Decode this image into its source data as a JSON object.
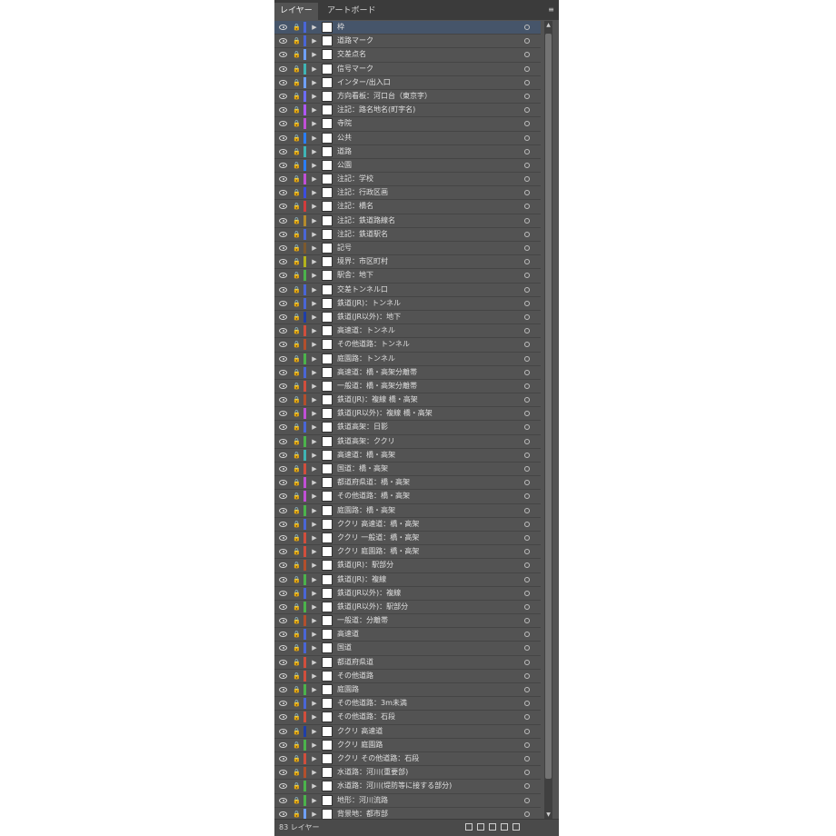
{
  "tabs": [
    "レイヤー",
    "アートボード"
  ],
  "footer": {
    "text": "83 レイヤー"
  },
  "layers": [
    {
      "name": "枠",
      "color": "#4a66d6",
      "selected": true
    },
    {
      "name": "道路マーク",
      "color": "#4a66d6"
    },
    {
      "name": "交差点名",
      "color": "#6ea0ff"
    },
    {
      "name": "信号マーク",
      "color": "#3fb5b5"
    },
    {
      "name": "インター/出入口",
      "color": "#6ea0ff"
    },
    {
      "name": "方向看板：河口台（東京字）",
      "color": "#6c6cff"
    },
    {
      "name": "注記：路名地名(町字名)",
      "color": "#b057ff"
    },
    {
      "name": "寺院",
      "color": "#c14fd6"
    },
    {
      "name": "公共",
      "color": "#2a7eff"
    },
    {
      "name": "道路",
      "color": "#3fb5b5"
    },
    {
      "name": "公園",
      "color": "#2a7eff"
    },
    {
      "name": "注記：学校",
      "color": "#c14fd6"
    },
    {
      "name": "注記：行政区画",
      "color": "#3b4de0"
    },
    {
      "name": "注記：橋名",
      "color": "#d13c3c"
    },
    {
      "name": "注記：鉄道路線名",
      "color": "#b58b2c"
    },
    {
      "name": "注記：鉄道駅名",
      "color": "#4a66d6"
    },
    {
      "name": "記号",
      "color": "#7c5a2e"
    },
    {
      "name": "境界：市区町村",
      "color": "#b3b31c"
    },
    {
      "name": "駅舎：地下",
      "color": "#4bb34b"
    },
    {
      "name": "交差トンネル口",
      "color": "#4a66d6"
    },
    {
      "name": "鉄道(JR)：トンネル",
      "color": "#4a66d6"
    },
    {
      "name": "鉄道(JR以外)：地下",
      "color": "#1f3ea8"
    },
    {
      "name": "高速道：トンネル",
      "color": "#d14e3c"
    },
    {
      "name": "その他道路：トンネル",
      "color": "#b34f2c"
    },
    {
      "name": "庭園路：トンネル",
      "color": "#4bb34b"
    },
    {
      "name": "高速道：橋・高架分離帯",
      "color": "#4a66d6"
    },
    {
      "name": "一般道：橋・高架分離帯",
      "color": "#d14e3c"
    },
    {
      "name": "鉄道(JR)：複線 橋・高架",
      "color": "#b34f2c"
    },
    {
      "name": "鉄道(JR以外)：複線 橋・高架",
      "color": "#c14fd6"
    },
    {
      "name": "鉄道高架：日影",
      "color": "#4a66d6"
    },
    {
      "name": "鉄道高架：ククリ",
      "color": "#4bb34b"
    },
    {
      "name": "高速道：橋・高架",
      "color": "#3fb5b5"
    },
    {
      "name": "国道：橋・高架",
      "color": "#d14e3c"
    },
    {
      "name": "都道府県道：橋・高架",
      "color": "#c14fd6"
    },
    {
      "name": "その他道路：橋・高架",
      "color": "#c14fd6"
    },
    {
      "name": "庭園路：橋・高架",
      "color": "#4bb34b"
    },
    {
      "name": "ククリ 高速道：橋・高架",
      "color": "#4a66d6"
    },
    {
      "name": "ククリ 一般道：橋・高架",
      "color": "#d14e3c"
    },
    {
      "name": "ククリ 庭園路：橋・高架",
      "color": "#d14e3c"
    },
    {
      "name": "鉄道(JR)：駅部分",
      "color": "#b34f2c"
    },
    {
      "name": "鉄道(JR)：複線",
      "color": "#4bb34b"
    },
    {
      "name": "鉄道(JR以外)：複線",
      "color": "#4a66d6"
    },
    {
      "name": "鉄道(JR以外)：駅部分",
      "color": "#4bb34b"
    },
    {
      "name": "一般道：分離帯",
      "color": "#b34f2c"
    },
    {
      "name": "高速道",
      "color": "#4a66d6"
    },
    {
      "name": "国道",
      "color": "#4a66d6"
    },
    {
      "name": "都道府県道",
      "color": "#d14e3c"
    },
    {
      "name": "その他道路",
      "color": "#d14e3c"
    },
    {
      "name": "庭園路",
      "color": "#4bb34b"
    },
    {
      "name": "その他道路：3m未満",
      "color": "#4a66d6"
    },
    {
      "name": "その他道路：石段",
      "color": "#d14e3c"
    },
    {
      "name": "ククリ 高速道",
      "color": "#1f3ea8"
    },
    {
      "name": "ククリ 庭園路",
      "color": "#4bb34b"
    },
    {
      "name": "ククリ その他道路：石段",
      "color": "#d14e3c"
    },
    {
      "name": "水道路：河川(重要部)",
      "color": "#b34f2c"
    },
    {
      "name": "水道路：河川(堤防等に接する部分)",
      "color": "#4bb34b"
    },
    {
      "name": "地形：河川流路",
      "color": "#4bb34b"
    },
    {
      "name": "背景地：都市部",
      "color": "#6ea0ff"
    }
  ]
}
